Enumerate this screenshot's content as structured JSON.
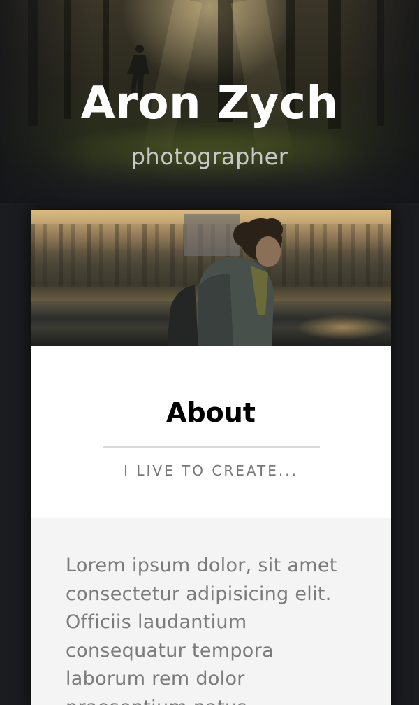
{
  "hero": {
    "title": "Aron Zych",
    "subtitle": "photographer"
  },
  "about": {
    "title": "About",
    "tagline": "I LIVE TO CREATE...",
    "body": "Lorem ipsum dolor, sit amet consectetur adipisicing elit. Officiis laudantium consequatur tempora laborum rem dolor praesentium natus"
  },
  "colors": {
    "background": "#1b1c1f",
    "card": "#ffffff",
    "card_body": "#f4f4f4",
    "title_text": "#000000",
    "muted_text": "#777777"
  }
}
